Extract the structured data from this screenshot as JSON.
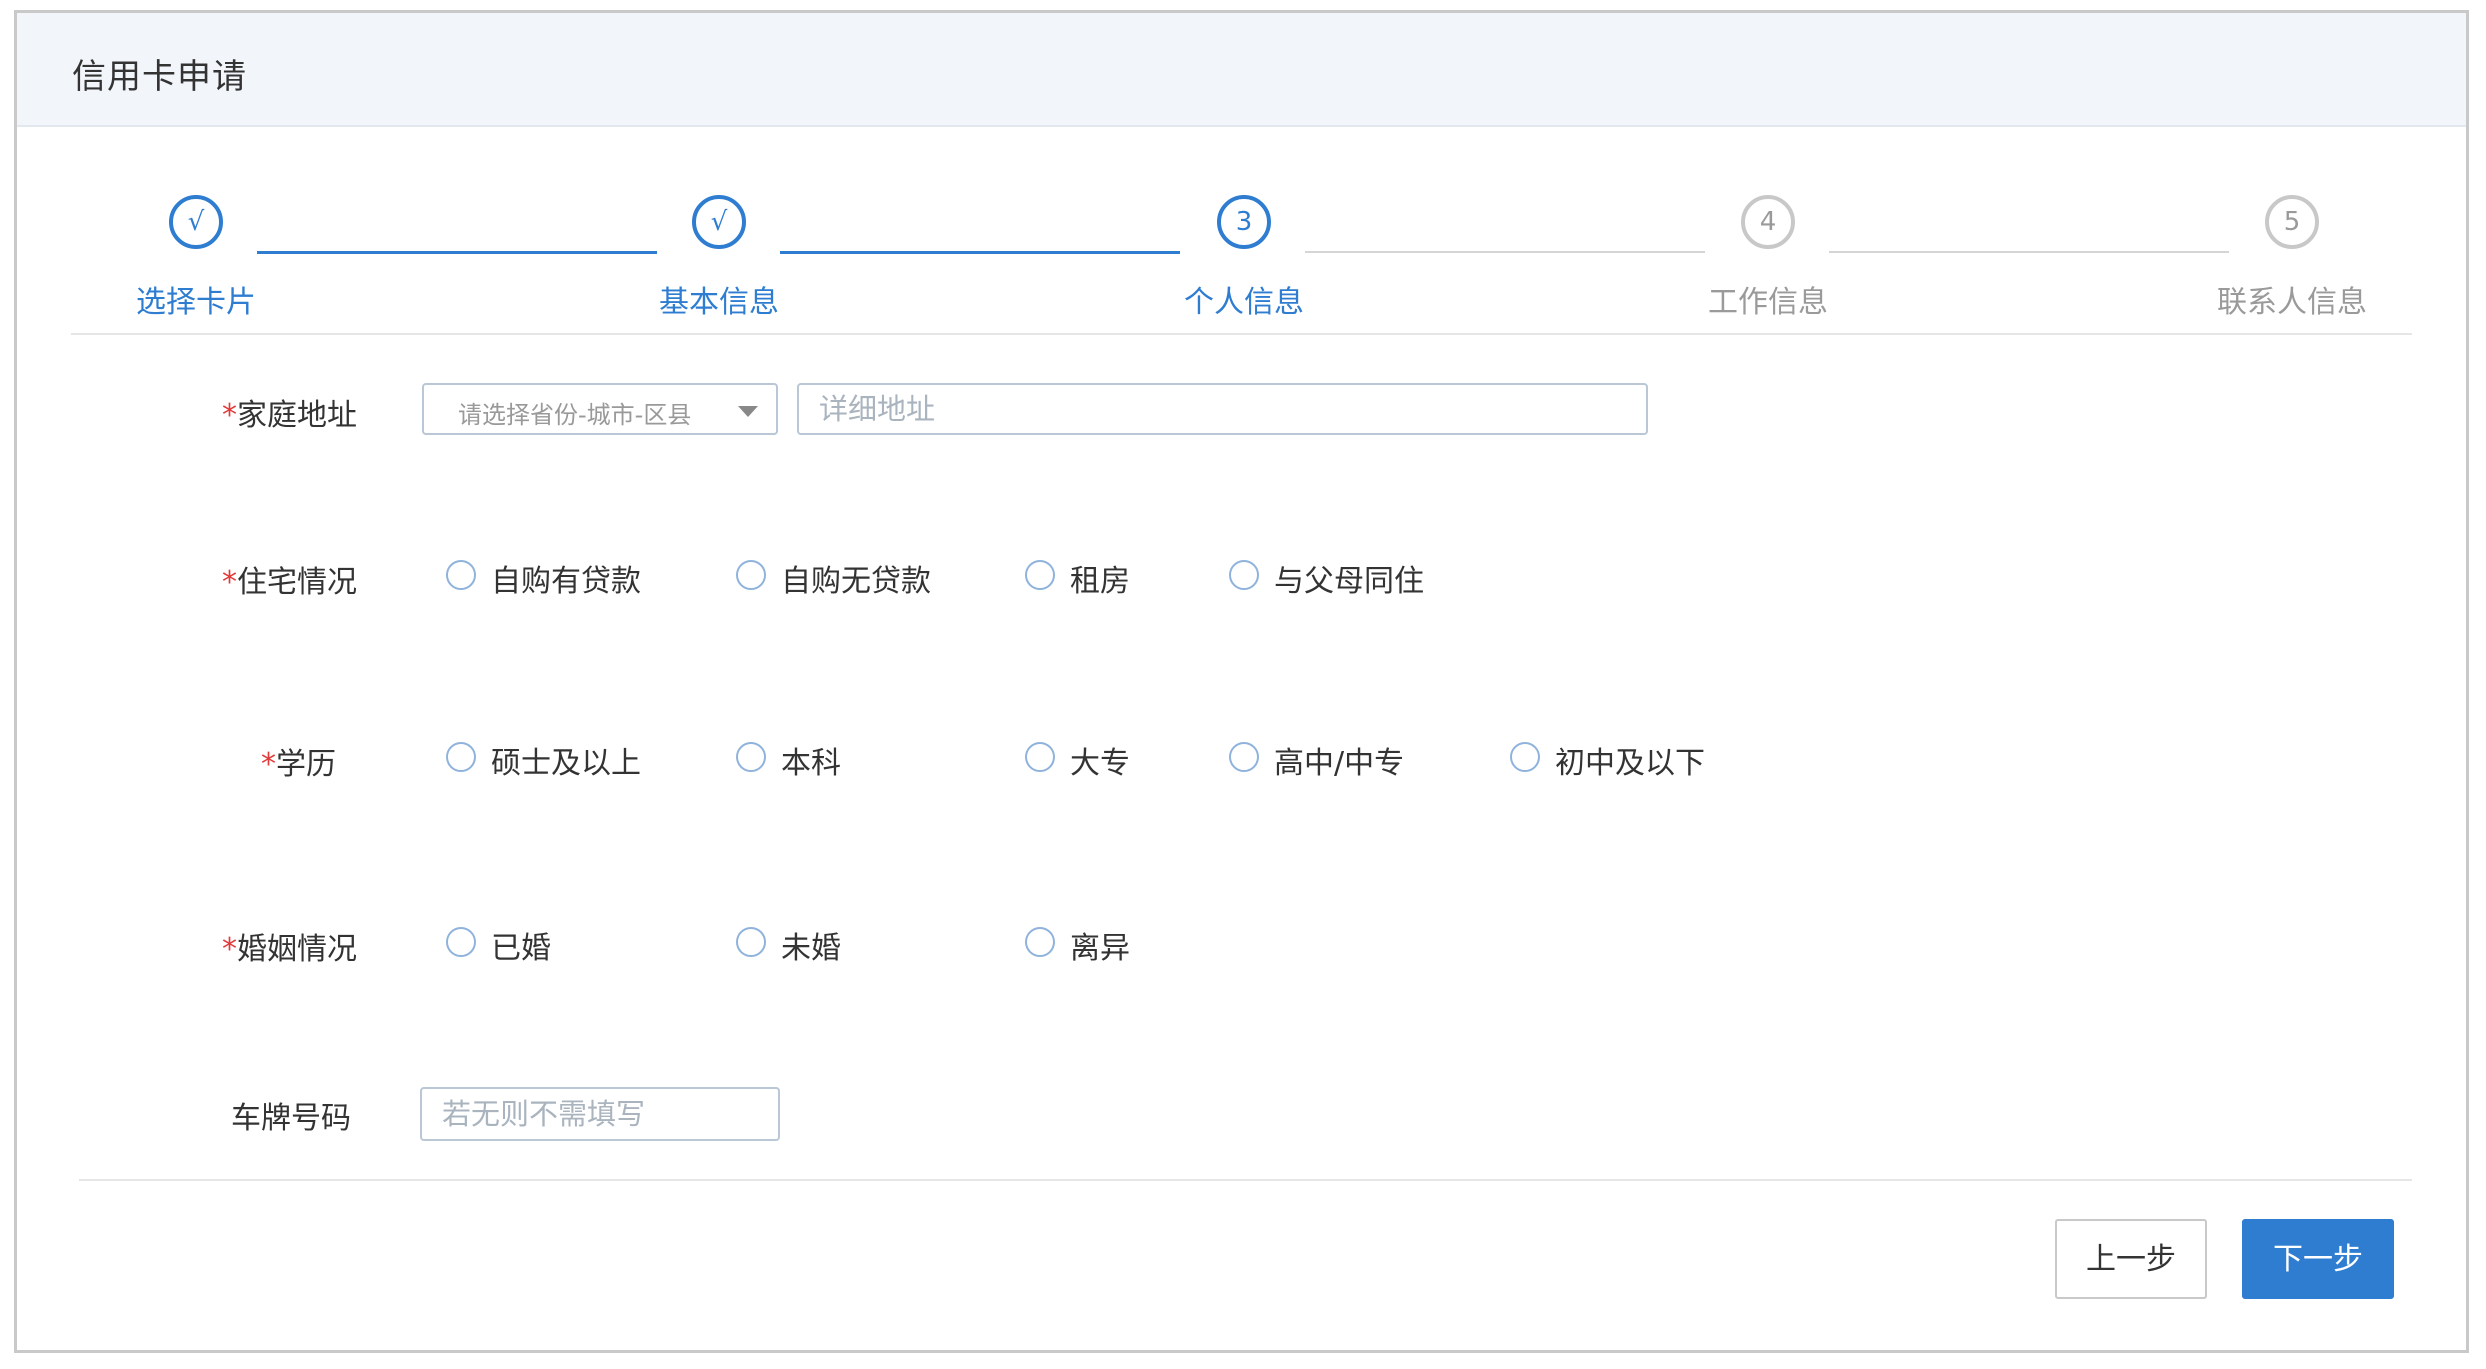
{
  "header": {
    "title": "信用卡申请"
  },
  "steps": [
    {
      "label": "选择卡片",
      "marker": "√",
      "status": "done"
    },
    {
      "label": "基本信息",
      "marker": "√",
      "status": "done"
    },
    {
      "label": "个人信息",
      "marker": "3",
      "status": "active"
    },
    {
      "label": "工作信息",
      "marker": "4",
      "status": "todo"
    },
    {
      "label": "联系人信息",
      "marker": "5",
      "status": "todo"
    }
  ],
  "form": {
    "required_mark": "*",
    "home_address": {
      "label": "家庭地址",
      "region_placeholder": "请选择省份-城市-区县",
      "detail_placeholder": "详细地址"
    },
    "housing": {
      "label": "住宅情况",
      "options": [
        "自购有贷款",
        "自购无贷款",
        "租房",
        "与父母同住"
      ]
    },
    "education": {
      "label": "学历",
      "options": [
        "硕士及以上",
        "本科",
        "大专",
        "高中/中专",
        "初中及以下"
      ]
    },
    "marriage": {
      "label": "婚姻情况",
      "options": [
        "已婚",
        "未婚",
        "离异"
      ]
    },
    "plate": {
      "label": "车牌号码",
      "placeholder": "若无则不需填写"
    }
  },
  "buttons": {
    "prev": "上一步",
    "next": "下一步"
  },
  "colors": {
    "accent": "#2e7dd1",
    "required": "#e23a3a",
    "inactive": "#9a9a9a"
  }
}
